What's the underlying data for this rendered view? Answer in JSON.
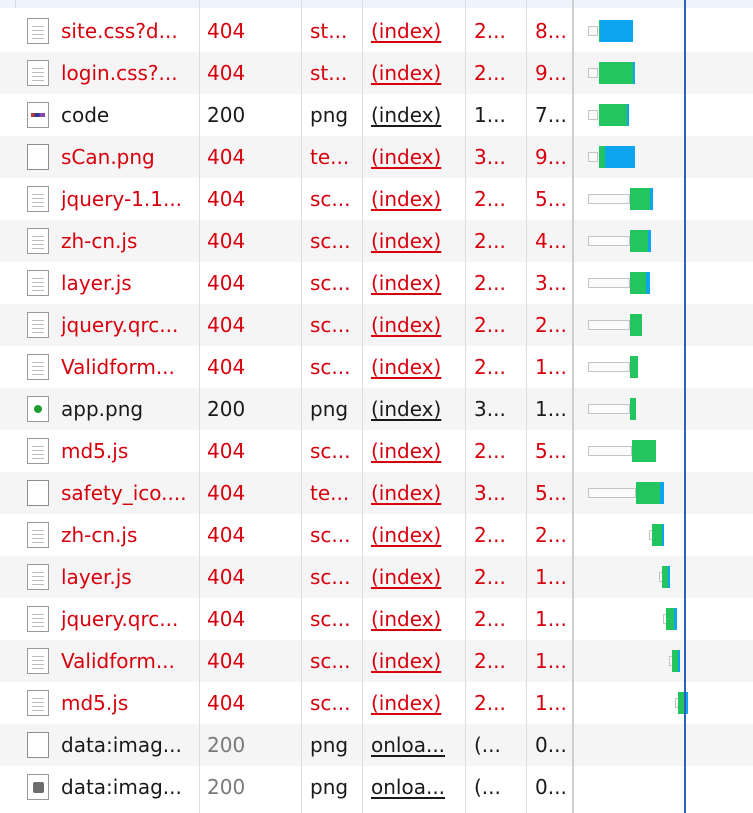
{
  "colors": {
    "error": "#d8000c",
    "ok": "#1a1a1a",
    "waterfall_green": "#22c55e",
    "waterfall_blue": "#0ea5f0",
    "marker_line": "#2f5fbf"
  },
  "rows": [
    {
      "name": "site.css?d...",
      "status": "404",
      "type": "st...",
      "initiator": "(index)",
      "size": "2...",
      "time": "8...",
      "icon": "doc-icon",
      "error": true,
      "wf": {
        "wait": 0.0,
        "green": 0,
        "blue": 0.08,
        "start": 0.05
      }
    },
    {
      "name": "login.css?...",
      "status": "404",
      "type": "st...",
      "initiator": "(index)",
      "size": "2...",
      "time": "9...",
      "icon": "doc-icon",
      "error": true
    },
    {
      "name": "code",
      "status": "200",
      "type": "png",
      "initiator": "(index)",
      "size": "1...",
      "time": "7...",
      "icon": "image-thumb-icon",
      "error": false
    },
    {
      "name": "sCan.png",
      "status": "404",
      "type": "te...",
      "initiator": "(index)",
      "size": "3...",
      "time": "9...",
      "icon": "blank-doc-icon",
      "error": true
    },
    {
      "name": "jquery-1.1...",
      "status": "404",
      "type": "sc...",
      "initiator": "(index)",
      "size": "2...",
      "time": "5...",
      "icon": "doc-icon",
      "error": true
    },
    {
      "name": "zh-cn.js",
      "status": "404",
      "type": "sc...",
      "initiator": "(index)",
      "size": "2...",
      "time": "4...",
      "icon": "doc-icon",
      "error": true
    },
    {
      "name": "layer.js",
      "status": "404",
      "type": "sc...",
      "initiator": "(index)",
      "size": "2...",
      "time": "3...",
      "icon": "doc-icon",
      "error": true
    },
    {
      "name": "jquery.qrc...",
      "status": "404",
      "type": "sc...",
      "initiator": "(index)",
      "size": "2...",
      "time": "2...",
      "icon": "doc-icon",
      "error": true
    },
    {
      "name": "Validform...",
      "status": "404",
      "type": "sc...",
      "initiator": "(index)",
      "size": "2...",
      "time": "1...",
      "icon": "doc-icon",
      "error": true
    },
    {
      "name": "app.png",
      "status": "200",
      "type": "png",
      "initiator": "(index)",
      "size": "3...",
      "time": "1...",
      "icon": "app-image-icon",
      "error": false
    },
    {
      "name": "md5.js",
      "status": "404",
      "type": "sc...",
      "initiator": "(index)",
      "size": "2...",
      "time": "5...",
      "icon": "doc-icon",
      "error": true
    },
    {
      "name": "safety_ico....",
      "status": "404",
      "type": "te...",
      "initiator": "(index)",
      "size": "3...",
      "time": "5...",
      "icon": "blank-doc-icon",
      "error": true
    },
    {
      "name": "zh-cn.js",
      "status": "404",
      "type": "sc...",
      "initiator": "(index)",
      "size": "2...",
      "time": "2...",
      "icon": "doc-icon",
      "error": true
    },
    {
      "name": "layer.js",
      "status": "404",
      "type": "sc...",
      "initiator": "(index)",
      "size": "2...",
      "time": "1...",
      "icon": "doc-icon",
      "error": true
    },
    {
      "name": "jquery.qrc...",
      "status": "404",
      "type": "sc...",
      "initiator": "(index)",
      "size": "2...",
      "time": "1...",
      "icon": "doc-icon",
      "error": true
    },
    {
      "name": "Validform...",
      "status": "404",
      "type": "sc...",
      "initiator": "(index)",
      "size": "2...",
      "time": "1...",
      "icon": "doc-icon",
      "error": true
    },
    {
      "name": "md5.js",
      "status": "404",
      "type": "sc...",
      "initiator": "(index)",
      "size": "2...",
      "time": "1...",
      "icon": "doc-icon",
      "error": true
    },
    {
      "name": "data:imag...",
      "status": "200",
      "type": "png",
      "initiator": "onloa...",
      "size": "(...",
      "time": "0...",
      "icon": "blank-doc-icon",
      "error": false,
      "dim_status": true
    },
    {
      "name": "data:imag...",
      "status": "200",
      "type": "png",
      "initiator": "onloa...",
      "size": "(...",
      "time": "0...",
      "icon": "gray-image-icon",
      "error": false,
      "dim_status": true
    }
  ]
}
